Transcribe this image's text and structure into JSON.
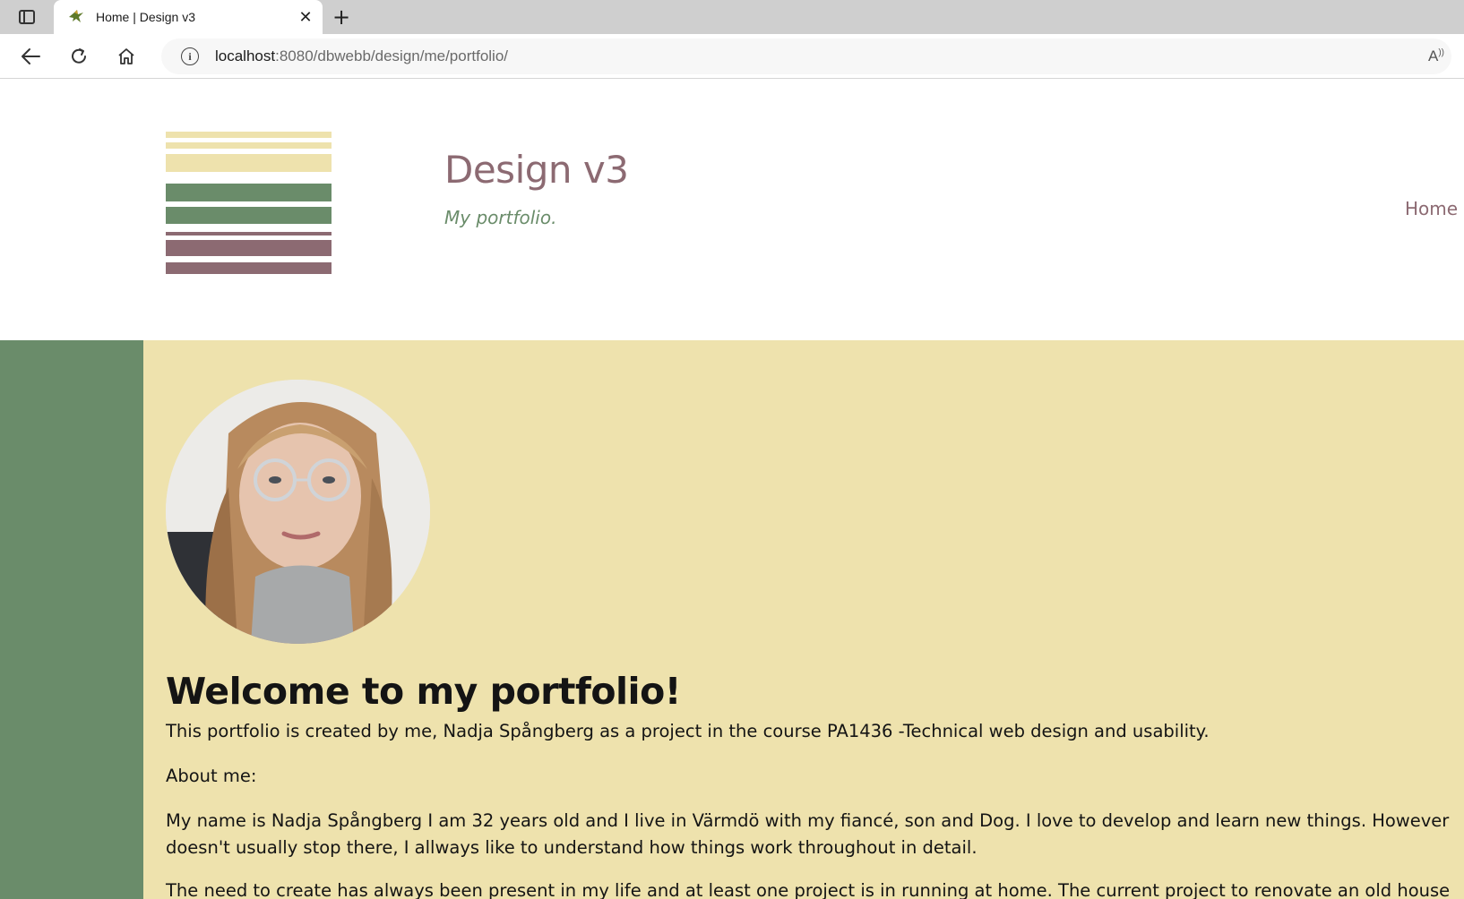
{
  "browser": {
    "tab_title": "Home | Design v3",
    "url_host": "localhost",
    "url_rest": ":8080/dbwebb/design/me/portfolio/",
    "read_aloud": "A̅"
  },
  "header": {
    "site_title": "Design v3",
    "slogan": "My portfolio.",
    "nav": [
      "Home"
    ]
  },
  "colors": {
    "sand": "#eee2ad",
    "green": "#6a8c6a",
    "mauve": "#8c6a72"
  },
  "main": {
    "heading": "Welcome to my portfolio!",
    "paragraphs": [
      "This portfolio is created by me, Nadja Spångberg as a project in the course PA1436 -Technical web design and usability.",
      "About me:",
      "My name is Nadja Spångberg I am 32 years old and I live in Värmdö with my fiancé, son and Dog. I love to develop and learn new things. However",
      "doesn't usually stop there, I allways like to understand how things work throughout in detail.",
      "The need to create has always been present in my life and at least one project is in running at home. The current project to renovate an old house"
    ]
  }
}
